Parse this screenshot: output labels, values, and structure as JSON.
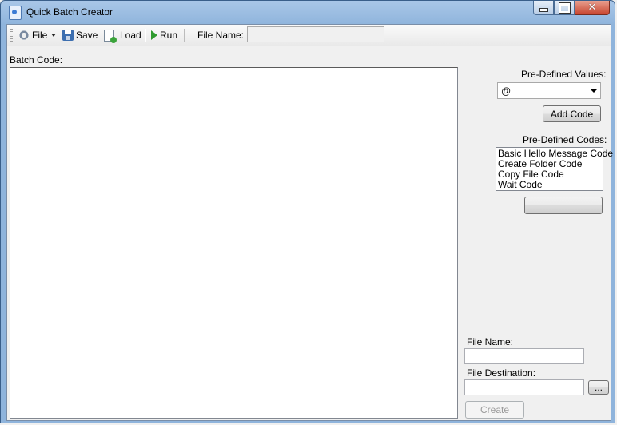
{
  "window": {
    "title": "Quick Batch Creator",
    "close_glyph": "✕"
  },
  "toolbar": {
    "file_label": "File",
    "save_label": "Save",
    "load_label": "Load",
    "run_label": "Run",
    "filename_label": "File Name:",
    "filename_value": ""
  },
  "editor": {
    "label": "Batch Code:",
    "value": ""
  },
  "side": {
    "predefined_values_label": "Pre-Defined Values:",
    "predefined_values_selected": "@",
    "add_code_label": "Add Code",
    "predefined_codes_label": "Pre-Defined Codes:",
    "predefined_codes": [
      "Basic Hello Message Code",
      "Create Folder Code",
      "Copy File Code",
      "Wait Code"
    ],
    "blank_button_label": "",
    "file_name_label": "File Name:",
    "file_name_value": "",
    "file_destination_label": "File Destination:",
    "file_destination_value": "",
    "browse_label": "...",
    "create_label": "Create"
  }
}
